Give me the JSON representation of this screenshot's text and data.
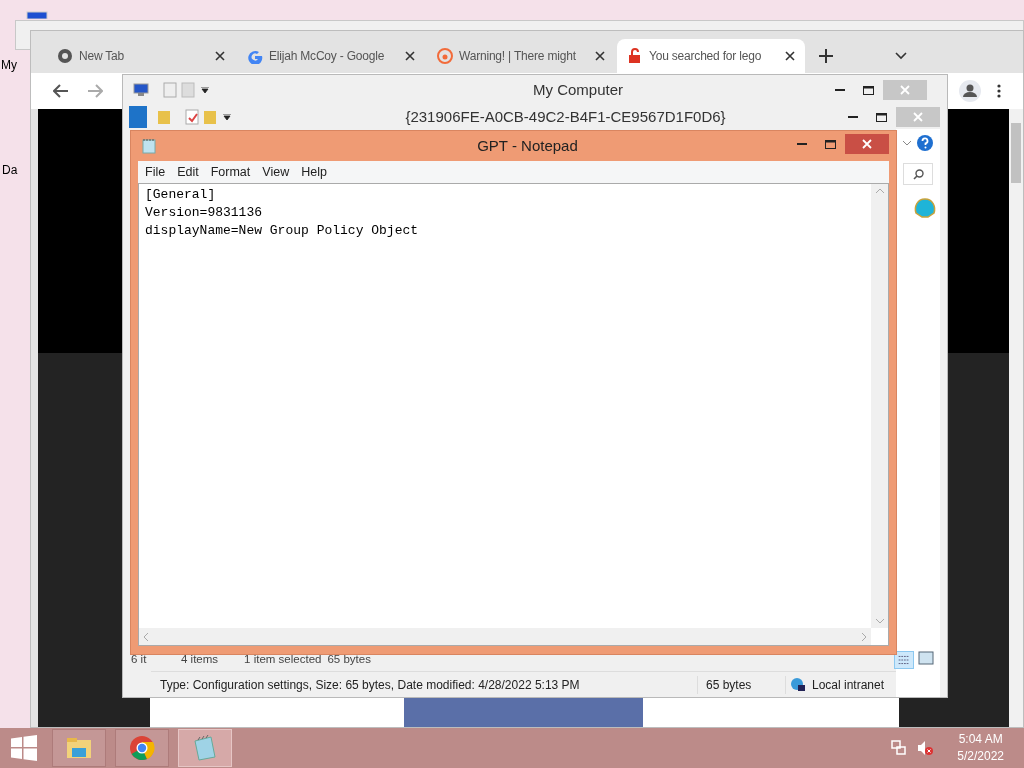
{
  "desktop": {
    "icon_labels": [
      "My",
      "Da"
    ]
  },
  "browser": {
    "tabs": [
      {
        "kind": "chrome",
        "title": "New Tab",
        "selected": false
      },
      {
        "kind": "google",
        "title": "Elijah McCoy - Google",
        "selected": false
      },
      {
        "kind": "warning",
        "title": "Warning! | There might",
        "selected": false
      },
      {
        "kind": "lock",
        "title": "You searched for lego",
        "selected": true
      }
    ]
  },
  "explorer": {
    "title": "My Computer",
    "folder_title": "{231906FE-A0CB-49C2-B4F1-CE9567D1F0D6}",
    "outer_status": "6 it",
    "item_count": "4 items",
    "selection": "1 item selected",
    "selection_size": "65 bytes",
    "details": "Type: Configuration settings, Size: 65 bytes, Date modified: 4/28/2022 5:13 PM",
    "size": "65 bytes",
    "zone": "Local intranet"
  },
  "notepad": {
    "title": "GPT - Notepad",
    "menu": [
      "File",
      "Edit",
      "Format",
      "View",
      "Help"
    ],
    "lines": [
      "[General]",
      "Version=9831136",
      "displayName=New Group Policy Object"
    ]
  },
  "taskbar": {
    "apps": [
      {
        "kind": "explorer",
        "active": false
      },
      {
        "kind": "chrome",
        "active": false
      },
      {
        "kind": "notepad",
        "active": true
      }
    ],
    "volume_muted": true,
    "time": "5:04 AM",
    "date": "5/2/2022"
  }
}
